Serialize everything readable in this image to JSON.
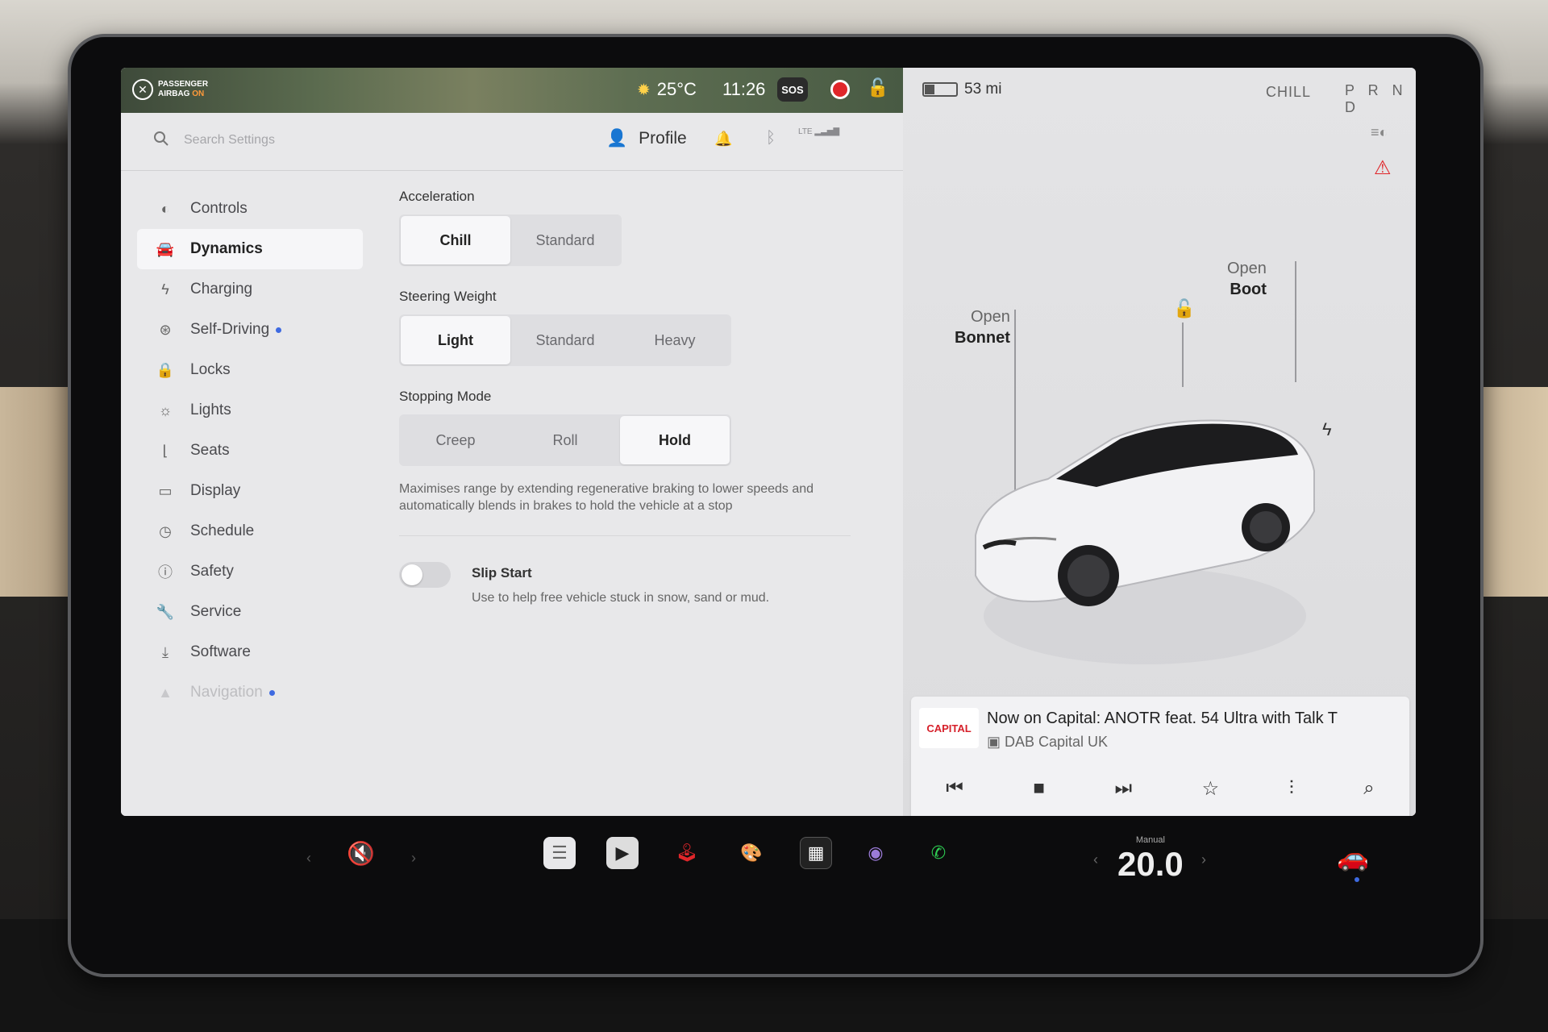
{
  "status": {
    "airbag_line1": "PASSENGER",
    "airbag_line2": "AIRBAG",
    "airbag_state": "ON",
    "temperature": "25°C",
    "time": "11:26",
    "sos": "SOS",
    "range": "53 mi",
    "battery_level": 0.3,
    "drive_mode": "CHILL",
    "gears": "P R N D"
  },
  "header": {
    "search_placeholder": "Search Settings",
    "profile_label": "Profile",
    "network": "LTE"
  },
  "sidebar": {
    "items": [
      {
        "label": "Controls",
        "icon": "toggle-icon"
      },
      {
        "label": "Dynamics",
        "icon": "car-icon"
      },
      {
        "label": "Charging",
        "icon": "bolt-icon"
      },
      {
        "label": "Self-Driving",
        "icon": "steering-wheel-icon"
      },
      {
        "label": "Locks",
        "icon": "lock-icon"
      },
      {
        "label": "Lights",
        "icon": "sun-icon"
      },
      {
        "label": "Seats",
        "icon": "seat-icon"
      },
      {
        "label": "Display",
        "icon": "display-icon"
      },
      {
        "label": "Schedule",
        "icon": "clock-icon"
      },
      {
        "label": "Safety",
        "icon": "alert-icon"
      },
      {
        "label": "Service",
        "icon": "wrench-icon"
      },
      {
        "label": "Software",
        "icon": "download-icon"
      },
      {
        "label": "Navigation",
        "icon": "navigation-icon"
      }
    ],
    "active": "Dynamics"
  },
  "dynamics": {
    "acceleration": {
      "title": "Acceleration",
      "options": [
        "Chill",
        "Standard"
      ],
      "selected": "Chill"
    },
    "steering": {
      "title": "Steering Weight",
      "options": [
        "Light",
        "Standard",
        "Heavy"
      ],
      "selected": "Light"
    },
    "stopping": {
      "title": "Stopping Mode",
      "options": [
        "Creep",
        "Roll",
        "Hold"
      ],
      "selected": "Hold",
      "description": "Maximises range by extending regenerative braking to lower speeds and automatically blends in brakes to hold the vehicle at a stop"
    },
    "slip_start": {
      "title": "Slip Start",
      "subtitle": "Use to help free vehicle stuck in snow, sand or mud.",
      "enabled": false
    }
  },
  "vehicle": {
    "bonnet_line1": "Open",
    "bonnet_line2": "Bonnet",
    "boot_line1": "Open",
    "boot_line2": "Boot"
  },
  "media": {
    "logo_text": "CAPITAL",
    "now_playing": "Now on Capital: ANOTR feat. 54 Ultra with Talk T",
    "station": "DAB Capital UK"
  },
  "climate": {
    "mode": "Manual",
    "temperature": "20.0"
  },
  "colors": {
    "accent_blue": "#3e6ae1",
    "alert_red": "#e0262a",
    "airbag_on": "#ff9a3a",
    "phone_green": "#2ecc52"
  }
}
